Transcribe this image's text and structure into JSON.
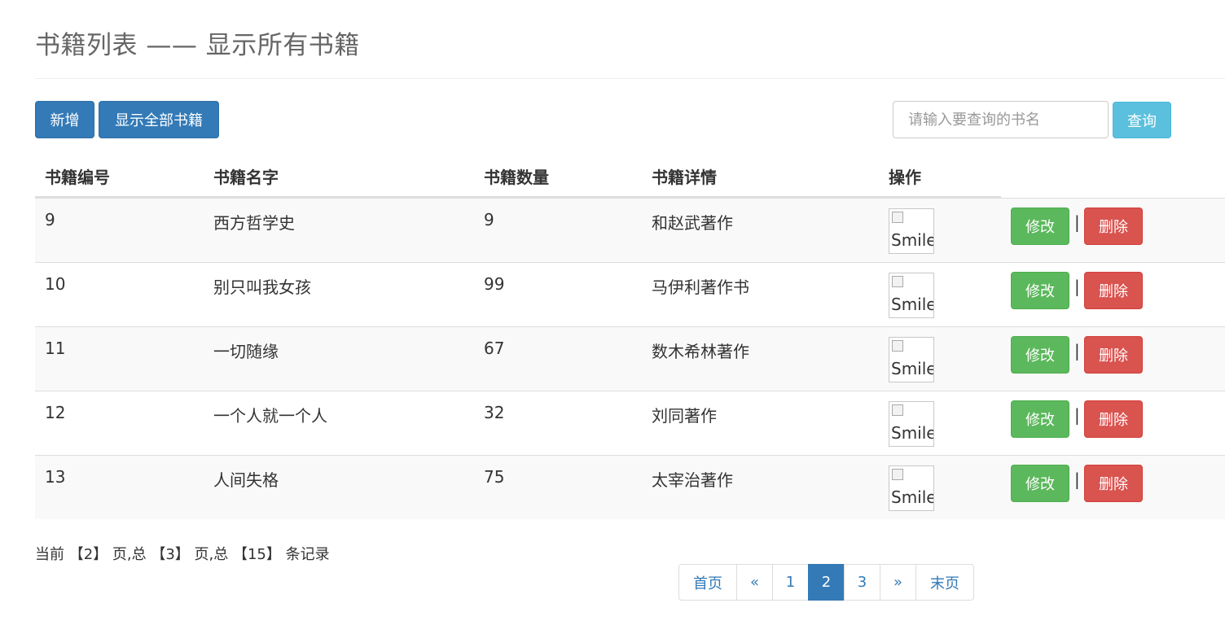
{
  "header": {
    "title": "书籍列表 —— 显示所有书籍"
  },
  "toolbar": {
    "add_label": "新增",
    "show_all_label": "显示全部书籍",
    "search_placeholder": "请输入要查询的书名",
    "search_value": "",
    "query_label": "查询"
  },
  "table": {
    "columns": [
      "书籍编号",
      "书籍名字",
      "书籍数量",
      "书籍详情",
      "操作"
    ],
    "rows": [
      {
        "id": "9",
        "name": "西方哲学史",
        "count": "9",
        "detail": "和赵武著作",
        "img_alt": "Smile"
      },
      {
        "id": "10",
        "name": "别只叫我女孩",
        "count": "99",
        "detail": "马伊利著作书",
        "img_alt": "Smile"
      },
      {
        "id": "11",
        "name": "一切随缘",
        "count": "67",
        "detail": "数木希林著作",
        "img_alt": "Smile"
      },
      {
        "id": "12",
        "name": "一个人就一个人",
        "count": "32",
        "detail": "刘同著作",
        "img_alt": "Smile"
      },
      {
        "id": "13",
        "name": "人间失格",
        "count": "75",
        "detail": "太宰治著作",
        "img_alt": "Smile"
      }
    ],
    "edit_label": "修改",
    "separator": "|",
    "delete_label": "删除"
  },
  "page_info": "当前 【2】 页,总 【3】 页,总 【15】 条记录",
  "pagination": {
    "items": [
      "首页",
      "«",
      "1",
      "2",
      "3",
      "»",
      "末页"
    ],
    "active": "2"
  },
  "colors": {
    "primary": "#337ab7",
    "info": "#5bc0de",
    "success": "#5cb85c",
    "danger": "#d9534f"
  }
}
